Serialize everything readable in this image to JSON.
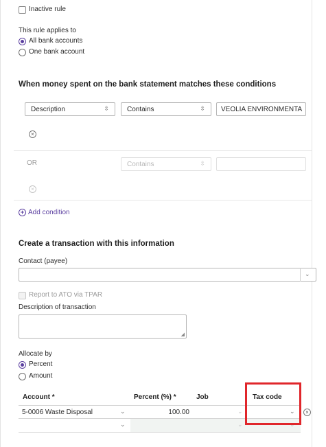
{
  "rule": {
    "inactive_label": "Inactive rule",
    "applies_heading": "This rule applies to",
    "options": [
      "All bank accounts",
      "One bank account"
    ],
    "selected_index": 0
  },
  "conditions": {
    "heading": "When money spent on the bank statement matches these conditions",
    "row1": {
      "field": "Description",
      "operator": "Contains",
      "value": "VEOLIA ENVIRONMENTA"
    },
    "row2": {
      "connector": "OR",
      "operator": "Contains",
      "value": ""
    },
    "add_label": "Add condition"
  },
  "transaction": {
    "heading": "Create a transaction with this information",
    "contact_label": "Contact (payee)",
    "contact_value": "",
    "report_label": "Report to ATO via TPAR",
    "desc_label": "Description of transaction",
    "desc_value": "",
    "allocate_label": "Allocate by",
    "allocate_options": [
      "Percent",
      "Amount"
    ],
    "allocate_selected": 0
  },
  "allocation_table": {
    "headers": [
      "Account *",
      "Percent (%) *",
      "Job",
      "Tax code"
    ],
    "rows": [
      {
        "account": "5-0006 Waste Disposal",
        "percent": "100.00",
        "job": "",
        "tax_code": ""
      },
      {
        "account": "",
        "percent": "",
        "job": "",
        "tax_code": ""
      }
    ]
  },
  "colors": {
    "accent": "#5b3fa0",
    "highlight": "#e0262b"
  }
}
